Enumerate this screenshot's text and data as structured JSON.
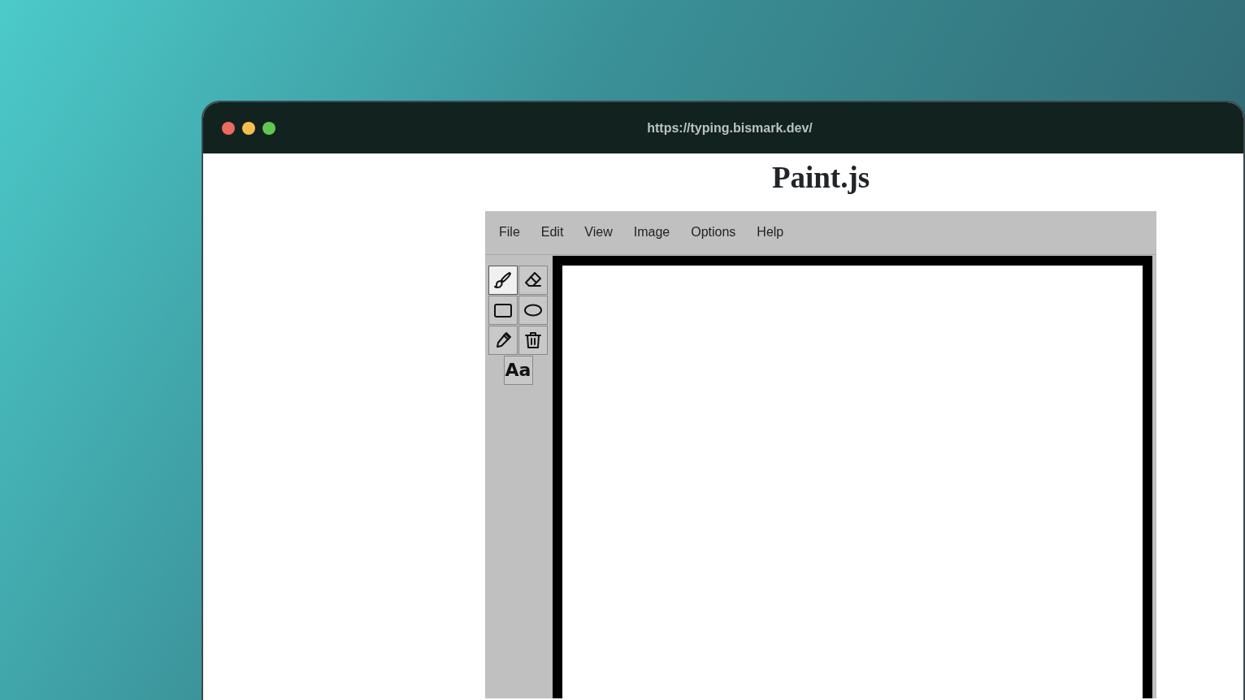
{
  "browser": {
    "url": "https://typing.bismark.dev/"
  },
  "page": {
    "title": "Paint.js"
  },
  "menu": [
    "File",
    "Edit",
    "View",
    "Image",
    "Options",
    "Help"
  ],
  "tools": [
    {
      "kind": "brush",
      "selected": true
    },
    {
      "kind": "eraser",
      "selected": false
    },
    {
      "kind": "rectangle",
      "selected": false
    },
    {
      "kind": "ellipse",
      "selected": false
    },
    {
      "kind": "picker",
      "selected": false
    },
    {
      "kind": "trash",
      "selected": false
    },
    {
      "kind": "text",
      "label": "Aa",
      "selected": false
    }
  ]
}
